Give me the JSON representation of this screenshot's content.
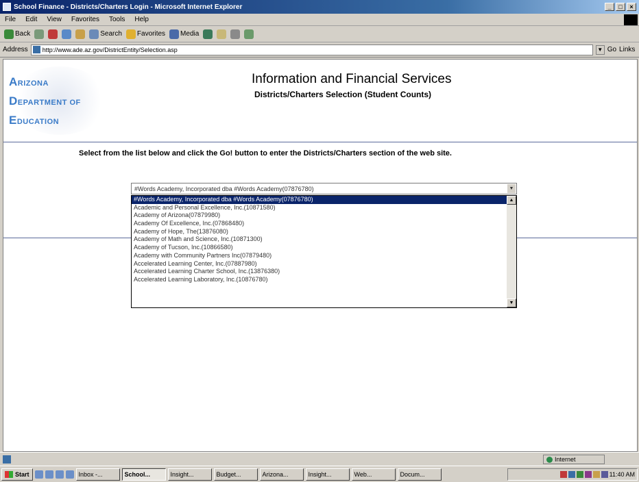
{
  "window": {
    "title": "School Finance - Districts/Charters Login - Microsoft Internet Explorer",
    "controls": [
      "_",
      "□",
      "×"
    ]
  },
  "menu": [
    "File",
    "Edit",
    "View",
    "Favorites",
    "Tools",
    "Help"
  ],
  "toolbar": {
    "back": "Back",
    "search": "Search",
    "favorites": "Favorites",
    "media": "Media"
  },
  "address": {
    "label": "Address",
    "url": "http://www.ade.az.gov/DistrictEntity/Selection.asp",
    "go": "Go",
    "links": "Links"
  },
  "logo": {
    "line1_cap": "A",
    "line1_rest": "RIZONA",
    "line2_cap": "D",
    "line2_rest": "EPARTMENT OF",
    "line3_cap": "E",
    "line3_rest": "DUCATION"
  },
  "header": {
    "title": "Information and Financial Services",
    "subtitle": "Districts/Charters Selection (Student Counts)"
  },
  "instruction": "Select from the list below and click the Go! button to enter the Districts/Charters section of the web site.",
  "selection": {
    "selected": "#Words Academy, Incorporated dba #Words Academy(07876780)",
    "options": [
      "#Words Academy, Incorporated dba #Words Academy(07876780)",
      "Academic and Personal Excellence, Inc.(10871580)",
      "Academy of Arizona(07879980)",
      "Academy Of Excellence, Inc.(07868480)",
      "Academy of Hope, The(13876080)",
      "Academy of Math and Science, Inc.(10871300)",
      "Academy of Tucson, Inc.(10866580)",
      "Academy with Community Partners Inc(07879480)",
      "Accelerated Learning Center, Inc.(07887980)",
      "Accelerated Learning Charter School, Inc.(13876380)",
      "Accelerated Learning Laboratory, Inc.(10876780)"
    ]
  },
  "status": {
    "zone": "Internet"
  },
  "taskbar": {
    "start": "Start",
    "tasks": [
      "Inbox -...",
      "School...",
      "Insight...",
      "Budget...",
      "Arizona...",
      "Insight...",
      "Web...",
      "Docum..."
    ],
    "active_index": 1,
    "clock": "11:40 AM"
  },
  "colors": {
    "titlebar": "#0a246a",
    "selection_highlight": "#0a246a",
    "logo_blue": "#3a7bc8"
  }
}
